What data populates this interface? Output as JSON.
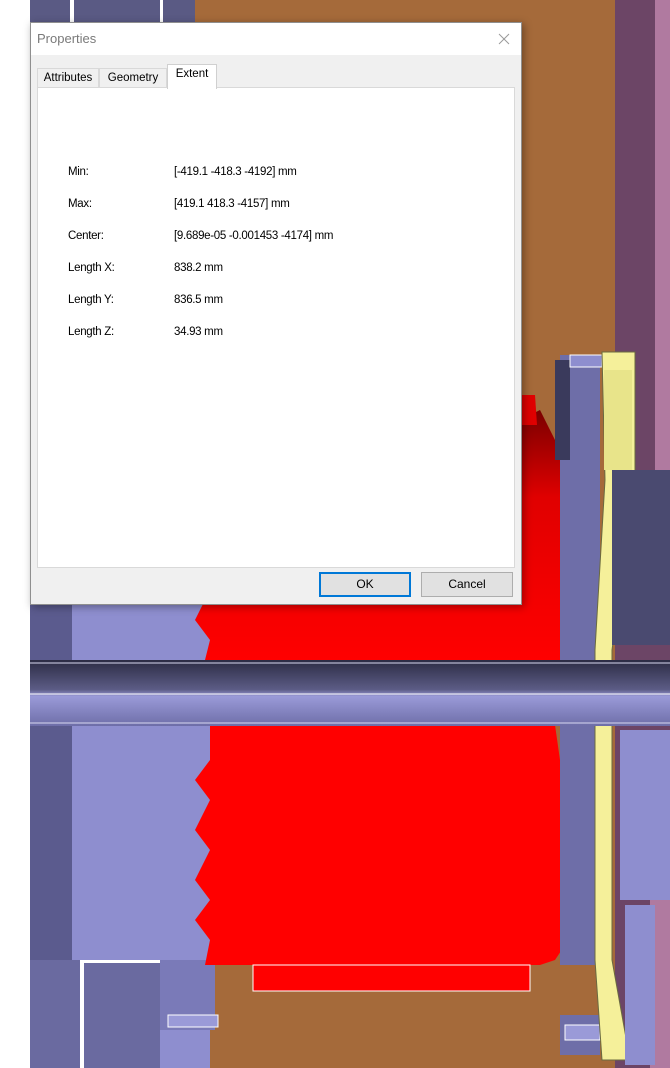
{
  "dialog": {
    "title": "Properties",
    "close_icon": "close-icon",
    "tabs": [
      {
        "label": "Attributes",
        "active": false
      },
      {
        "label": "Geometry",
        "active": false
      },
      {
        "label": "Extent",
        "active": true
      }
    ],
    "extent": {
      "rows": [
        {
          "label": "Min:",
          "value": "[-419.1 -418.3 -4192] mm"
        },
        {
          "label": "Max:",
          "value": "[419.1 418.3 -4157] mm"
        },
        {
          "label": "Center:",
          "value": "[9.689e-05 -0.001453 -4174] mm"
        },
        {
          "label": "Length X:",
          "value": "838.2 mm"
        },
        {
          "label": "Length Y:",
          "value": "836.5 mm"
        },
        {
          "label": "Length Z:",
          "value": "34.93 mm"
        }
      ]
    },
    "buttons": {
      "ok": "OK",
      "cancel": "Cancel"
    }
  },
  "colors": {
    "red_part": "#ff0000",
    "dark_red_part": "#8a0000",
    "lavender_part": "#8e8ecf",
    "yellow_part": "#f5f09a",
    "brown_background": "#a56a3a",
    "purple_panel": "#6c4566",
    "accent_default_button": "#0078d7"
  }
}
